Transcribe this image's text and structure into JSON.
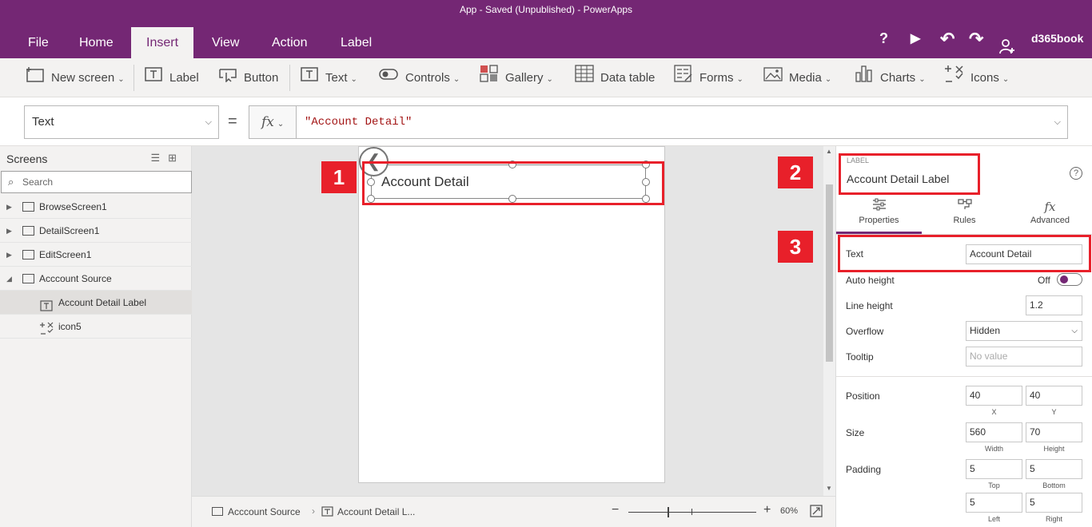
{
  "title": "App - Saved (Unpublished) - PowerApps",
  "menu": {
    "file": "File",
    "home": "Home",
    "insert": "Insert",
    "view": "View",
    "action": "Action",
    "label": "Label",
    "help": "?",
    "play": "▶",
    "undo": "↶",
    "redo": "↷",
    "user_icon": "person-add-icon",
    "user": "d365book"
  },
  "ribbon": {
    "new_screen": "New screen",
    "label": "Label",
    "button": "Button",
    "text": "Text",
    "controls": "Controls",
    "gallery": "Gallery",
    "data_table": "Data table",
    "forms": "Forms",
    "media": "Media",
    "charts": "Charts",
    "icons": "Icons"
  },
  "formula": {
    "property": "Text",
    "equals": "=",
    "fx": "fx",
    "value": "\"Account Detail\""
  },
  "left": {
    "title": "Screens",
    "search_placeholder": "Search",
    "items": [
      {
        "label": "BrowseScreen1"
      },
      {
        "label": "DetailScreen1"
      },
      {
        "label": "EditScreen1"
      },
      {
        "label": "Acccount Source"
      },
      {
        "label": "Account Detail Label"
      },
      {
        "label": "icon5"
      }
    ]
  },
  "canvas": {
    "label_text": "Account Detail",
    "callouts": [
      "1",
      "2",
      "3"
    ]
  },
  "bottom": {
    "screen": "Acccount Source",
    "control": "Account Detail L...",
    "zoom_minus": "−",
    "zoom_plus": "+",
    "zoom": "60%"
  },
  "right": {
    "type": "LABEL",
    "name": "Account Detail Label",
    "help": "?",
    "tabs": {
      "properties": "Properties",
      "rules": "Rules",
      "advanced": "Advanced"
    },
    "text_label": "Text",
    "text_value": "Account Detail",
    "auto_height_label": "Auto height",
    "auto_height_value": "Off",
    "line_height_label": "Line height",
    "line_height_value": "1.2",
    "overflow_label": "Overflow",
    "overflow_value": "Hidden",
    "tooltip_label": "Tooltip",
    "tooltip_placeholder": "No value",
    "position_label": "Position",
    "pos_x": "40",
    "pos_y": "40",
    "x_label": "X",
    "y_label": "Y",
    "size_label": "Size",
    "width": "560",
    "height": "70",
    "width_label": "Width",
    "height_label": "Height",
    "padding_label": "Padding",
    "pad_top": "5",
    "pad_bottom": "5",
    "pad_left": "5",
    "pad_right": "5",
    "top_label": "Top",
    "bottom_label": "Bottom",
    "left_label": "Left",
    "right_label": "Right"
  },
  "colors": {
    "brand": "#742774",
    "callout": "#e8202a"
  }
}
